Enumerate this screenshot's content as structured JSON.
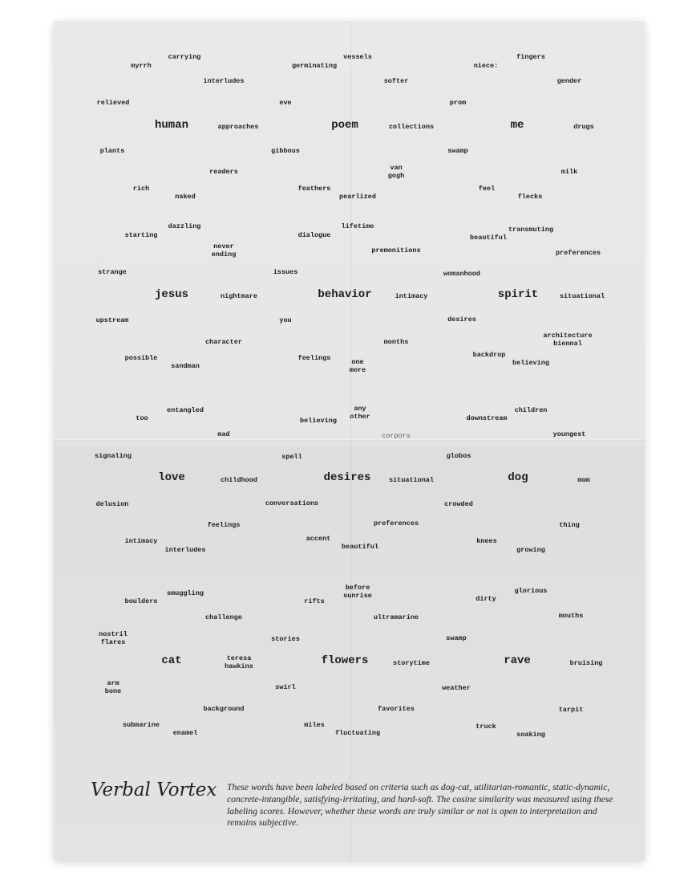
{
  "footer": {
    "title": "Verbal Vortex",
    "description": "These words have been labeled based on criteria such as dog-cat, utilitarian-romantic, static-dynamic, concrete-intangible, satisfying-irritating, and hard-soft. The cosine similarity was measured using these labeling scores. However, whether these words are truly similar or not is open to interpretation and remains subjective."
  },
  "words": [
    {
      "text": "carrying"
    },
    {
      "text": "myrrh"
    },
    {
      "text": "vessels"
    },
    {
      "text": "germinating"
    },
    {
      "text": "fingers"
    },
    {
      "text": "niece:"
    },
    {
      "text": "interludes"
    },
    {
      "text": "softer"
    },
    {
      "text": "gender"
    },
    {
      "text": "relieved"
    },
    {
      "text": "eve"
    },
    {
      "text": "prom"
    },
    {
      "text": "human",
      "big": true
    },
    {
      "text": "approaches"
    },
    {
      "text": "poem",
      "big": true
    },
    {
      "text": "collections"
    },
    {
      "text": "me",
      "big": true
    },
    {
      "text": "drugs"
    },
    {
      "text": "plants"
    },
    {
      "text": "gibbous"
    },
    {
      "text": "swamp"
    },
    {
      "text": "readers"
    },
    {
      "text": "van\ngogh"
    },
    {
      "text": "milk"
    },
    {
      "text": "rich"
    },
    {
      "text": "naked"
    },
    {
      "text": "feathers"
    },
    {
      "text": "pearlized"
    },
    {
      "text": "feel"
    },
    {
      "text": "flecks"
    },
    {
      "text": "dazzling"
    },
    {
      "text": "starting"
    },
    {
      "text": "lifetime"
    },
    {
      "text": "dialogue"
    },
    {
      "text": "transmuting"
    },
    {
      "text": "beautiful"
    },
    {
      "text": "never\nending"
    },
    {
      "text": "premonitions"
    },
    {
      "text": "preferences"
    },
    {
      "text": "strange"
    },
    {
      "text": "issues"
    },
    {
      "text": "womanhood"
    },
    {
      "text": "jesus",
      "big": true
    },
    {
      "text": "nightmare"
    },
    {
      "text": "behavior",
      "big": true
    },
    {
      "text": "intimacy"
    },
    {
      "text": "spirit",
      "big": true
    },
    {
      "text": "situational"
    },
    {
      "text": "upstream"
    },
    {
      "text": "you"
    },
    {
      "text": "desires"
    },
    {
      "text": "architecture\nbiennal"
    },
    {
      "text": "character"
    },
    {
      "text": "months"
    },
    {
      "text": "possible"
    },
    {
      "text": "feelings"
    },
    {
      "text": "one\nmore"
    },
    {
      "text": "backdrop"
    },
    {
      "text": "sandman"
    },
    {
      "text": "believing"
    },
    {
      "text": "entangled"
    },
    {
      "text": "any\nother"
    },
    {
      "text": "children"
    },
    {
      "text": "too"
    },
    {
      "text": "believing"
    },
    {
      "text": "downstream"
    },
    {
      "text": "mad"
    },
    {
      "text": "corpors",
      "light": true
    },
    {
      "text": "youngest"
    },
    {
      "text": "signaling"
    },
    {
      "text": "spell"
    },
    {
      "text": "globos"
    },
    {
      "text": "love",
      "big": true
    },
    {
      "text": "childhood"
    },
    {
      "text": "desires",
      "big": true
    },
    {
      "text": "situational"
    },
    {
      "text": "dog",
      "big": true
    },
    {
      "text": "mom"
    },
    {
      "text": "delusion"
    },
    {
      "text": "conversations"
    },
    {
      "text": "crowded"
    },
    {
      "text": "feelings"
    },
    {
      "text": "preferences"
    },
    {
      "text": "thing"
    },
    {
      "text": "intimacy"
    },
    {
      "text": "accent"
    },
    {
      "text": "knees"
    },
    {
      "text": "interludes"
    },
    {
      "text": "beautiful"
    },
    {
      "text": "growing"
    },
    {
      "text": "smuggling"
    },
    {
      "text": "before\nsunrise"
    },
    {
      "text": "glorious"
    },
    {
      "text": "boulders"
    },
    {
      "text": "rifts"
    },
    {
      "text": "dirty"
    },
    {
      "text": "challenge"
    },
    {
      "text": "ultramarine"
    },
    {
      "text": "mouths"
    },
    {
      "text": "nostril\nflares"
    },
    {
      "text": "stories"
    },
    {
      "text": "swamp"
    },
    {
      "text": "cat",
      "big": true
    },
    {
      "text": "teresa\nhawkins"
    },
    {
      "text": "flowers",
      "big": true
    },
    {
      "text": "storytime"
    },
    {
      "text": "rave",
      "big": true
    },
    {
      "text": "bruising"
    },
    {
      "text": "arm\nbone"
    },
    {
      "text": "swirl"
    },
    {
      "text": "weather"
    },
    {
      "text": "background"
    },
    {
      "text": "favorites"
    },
    {
      "text": "tarpit"
    },
    {
      "text": "submarine"
    },
    {
      "text": "miles"
    },
    {
      "text": "truck"
    },
    {
      "text": "enamel"
    },
    {
      "text": "fluctuating"
    },
    {
      "text": "soaking"
    }
  ]
}
